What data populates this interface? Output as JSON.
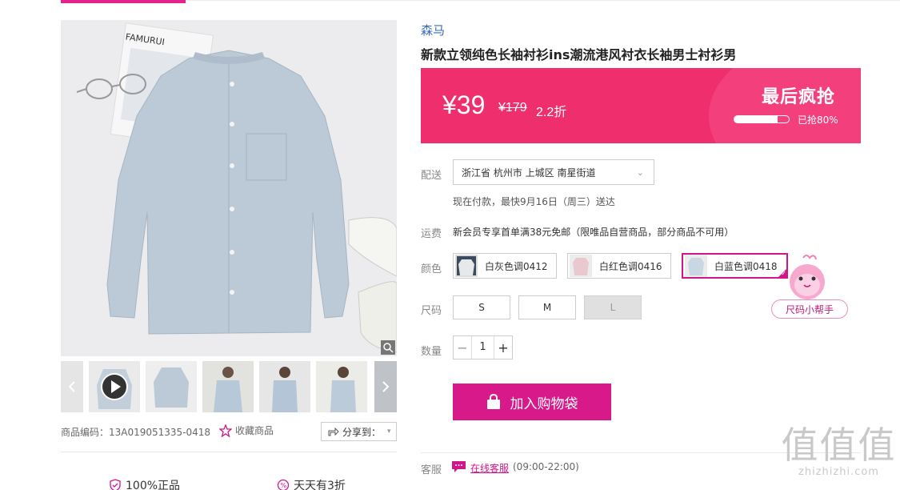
{
  "brand": "森马",
  "product_title": "新款立领纯色长袖衬衫ins潮流港风衬衣长袖男士衬衫男",
  "price": {
    "current": "¥39",
    "original": "¥179",
    "discount": "2.2折",
    "promo_title": "最后疯抢",
    "sold_progress": 0.8,
    "sold_text": "已抢80%"
  },
  "delivery": {
    "label": "配送",
    "address": "浙江省 杭州市 上城区 南星街道",
    "eta_note": "现在付款，最快9月16日（周三）送达"
  },
  "shipping": {
    "label": "运费",
    "text": "新会员专享首单满38元免邮（限唯品自营商品，部分商品不可用）"
  },
  "colors": {
    "label": "颜色",
    "options": [
      {
        "name": "白灰色调0412",
        "swatch": "#cfd5dc"
      },
      {
        "name": "白红色调0416",
        "swatch": "#e9c9cf"
      },
      {
        "name": "白蓝色调0418",
        "swatch": "#c9d6e3"
      }
    ],
    "selected_index": 2
  },
  "sizes": {
    "label": "尺码",
    "options": [
      "S",
      "M",
      "L"
    ],
    "disabled": [
      "L"
    ]
  },
  "size_helper": "尺码小帮手",
  "quantity": {
    "label": "数量",
    "value": "1"
  },
  "cart_button": "加入购物袋",
  "service": {
    "label": "客服",
    "link_text": "在线客服",
    "hours": "(09:00-22:00)"
  },
  "gallery": {
    "sku": "商品编码：13A019051335-0418",
    "favorite": "收藏商品",
    "share": "分享到：",
    "magazine_text": "FAMURUI"
  },
  "promises": [
    "100%正品",
    "天天有3折"
  ],
  "watermark": {
    "big": "值值值",
    "small": "zhizhizhi.com"
  },
  "colors_theme": {
    "accent": "#d8198a",
    "banner": "#ee2e6d",
    "brand_link": "#3a6bb8"
  }
}
